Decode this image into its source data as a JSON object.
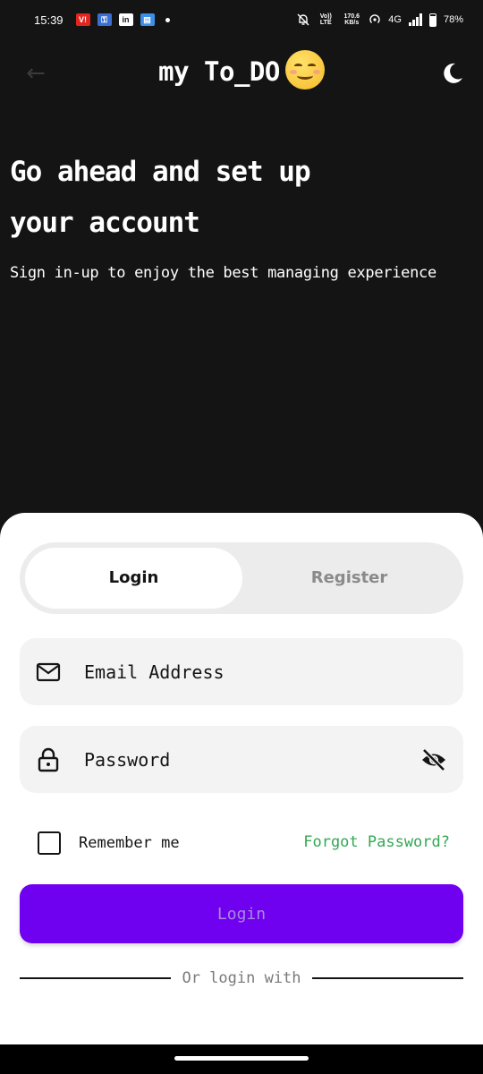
{
  "status_bar": {
    "time": "15:39",
    "app_icons": [
      "V!",
      "key",
      "in",
      "msg"
    ],
    "volte": "Vo)) LTE",
    "speed": "170.6 KB/s",
    "network": "4G",
    "battery": "78%"
  },
  "header": {
    "title": "my To_DO",
    "emoji": "smiling-face-emoji"
  },
  "hero": {
    "title_line1": "Go ahead and set up",
    "title_line2": "your account",
    "subtitle": "Sign in-up to enjoy the best managing experience"
  },
  "tabs": {
    "login": "Login",
    "register": "Register",
    "active": "login"
  },
  "form": {
    "email_placeholder": "Email Address",
    "password_placeholder": "Password",
    "remember_label": "Remember me",
    "forgot_label": "Forgot Password?",
    "submit_label": "Login",
    "divider_text": "Or login with"
  },
  "colors": {
    "background": "#141414",
    "primary": "#6f00f0",
    "accent_link": "#34a853"
  }
}
